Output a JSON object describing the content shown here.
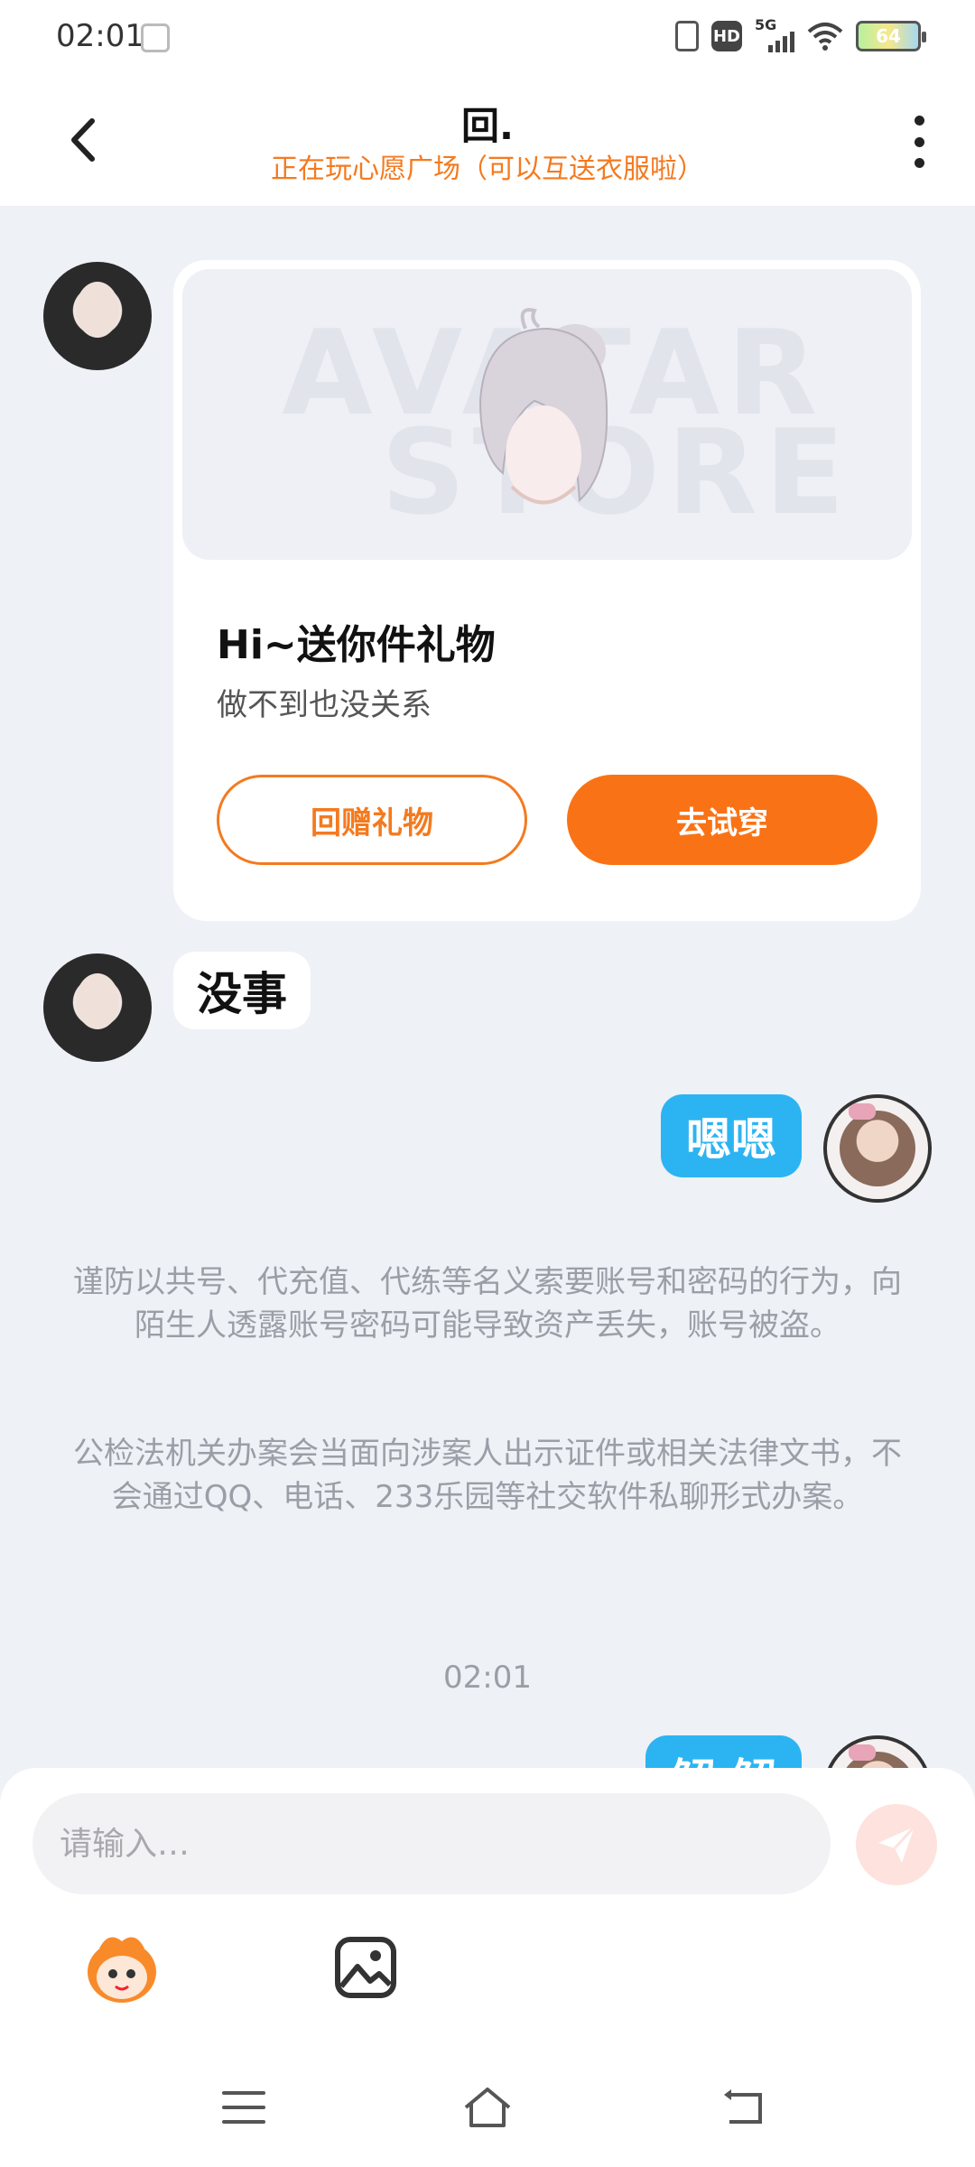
{
  "status_bar": {
    "time": "02:01",
    "hd": "HD",
    "network": "5G",
    "battery": "64"
  },
  "header": {
    "title": "回.",
    "subtitle": "正在玩心愿广场（可以互送衣服啦）"
  },
  "gift_card": {
    "watermark_line1": "AVATAR",
    "watermark_line2": "STORE",
    "title": "Hi~送你件礼物",
    "description": "做不到也没关系",
    "return_button": "回赠礼物",
    "try_button": "去试穿"
  },
  "messages": [
    {
      "side": "left",
      "text": "没事"
    },
    {
      "side": "right",
      "text": "嗯嗯"
    },
    {
      "side": "right",
      "text": "解 解"
    }
  ],
  "notices": {
    "notice1": "谨防以共号、代充值、代练等名义索要账号和密码的行为，向陌生人透露账号密码可能导致资产丢失，账号被盗。",
    "notice2": "公检法机关办案会当面向涉案人出示证件或相关法律文书，不会通过QQ、电话、233乐园等社交软件私聊形式办案。"
  },
  "timestamp": "02:01",
  "input": {
    "placeholder": "请输入…"
  },
  "colors": {
    "accent_orange": "#f97316",
    "bubble_blue": "#2cb4f2",
    "background": "#eef1f6"
  }
}
